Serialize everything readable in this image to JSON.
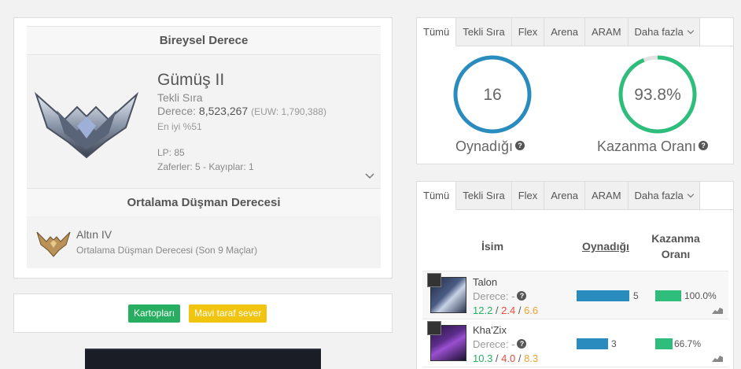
{
  "ranked": {
    "header": "Bireysel Derece",
    "tier": "Gümüş II",
    "queue": "Tekli Sıra",
    "ladder_label": "Derece:",
    "ladder_value": "8,523,267",
    "ladder_region": "(EUW: 1,790,388)",
    "top_percent": "En iyi %51",
    "lp": "LP: 85",
    "win_loss": "Zaferler: 5 - Kayıplar: 1"
  },
  "enemy": {
    "header": "Ortalama Düşman Derecesi",
    "tier": "Altın IV",
    "subtitle": "Ortalama Düşman Derecesi (Son 9 Maçlar)"
  },
  "tags": {
    "cards": "Kartopları",
    "blue_side": "Mavi taraf sever"
  },
  "tabs": [
    "Tümü",
    "Tekli Sıra",
    "Flex",
    "Arena",
    "ARAM",
    "Daha fazla"
  ],
  "stats": {
    "played_value": "16",
    "played_label": "Oynadığı",
    "winrate_value": "93.8%",
    "winrate_label": "Kazanma Oranı",
    "winrate_fraction": 0.938
  },
  "champ_table": {
    "col_name": "İsim",
    "col_played": "Oynadığı",
    "col_win": "Kazanma Oranı",
    "rows": [
      {
        "name": "Talon",
        "rank": "Derece: -",
        "k": "12.2",
        "d": "2.4",
        "a": "6.6",
        "played": "5",
        "played_fraction": 1.0,
        "winrate": "100.0%",
        "winrate_fraction": 1.0
      },
      {
        "name": "Kha'Zix",
        "rank": "Derece: -",
        "k": "10.3",
        "d": "4.0",
        "a": "8.3",
        "played": "3",
        "played_fraction": 0.6,
        "winrate": "66.7%",
        "winrate_fraction": 0.667
      }
    ]
  },
  "colors": {
    "gauge_blue": "#2a8bbf",
    "gauge_green": "#2ebd7a",
    "tag_green": "#27ae60",
    "tag_yellow": "#f1c40f"
  }
}
